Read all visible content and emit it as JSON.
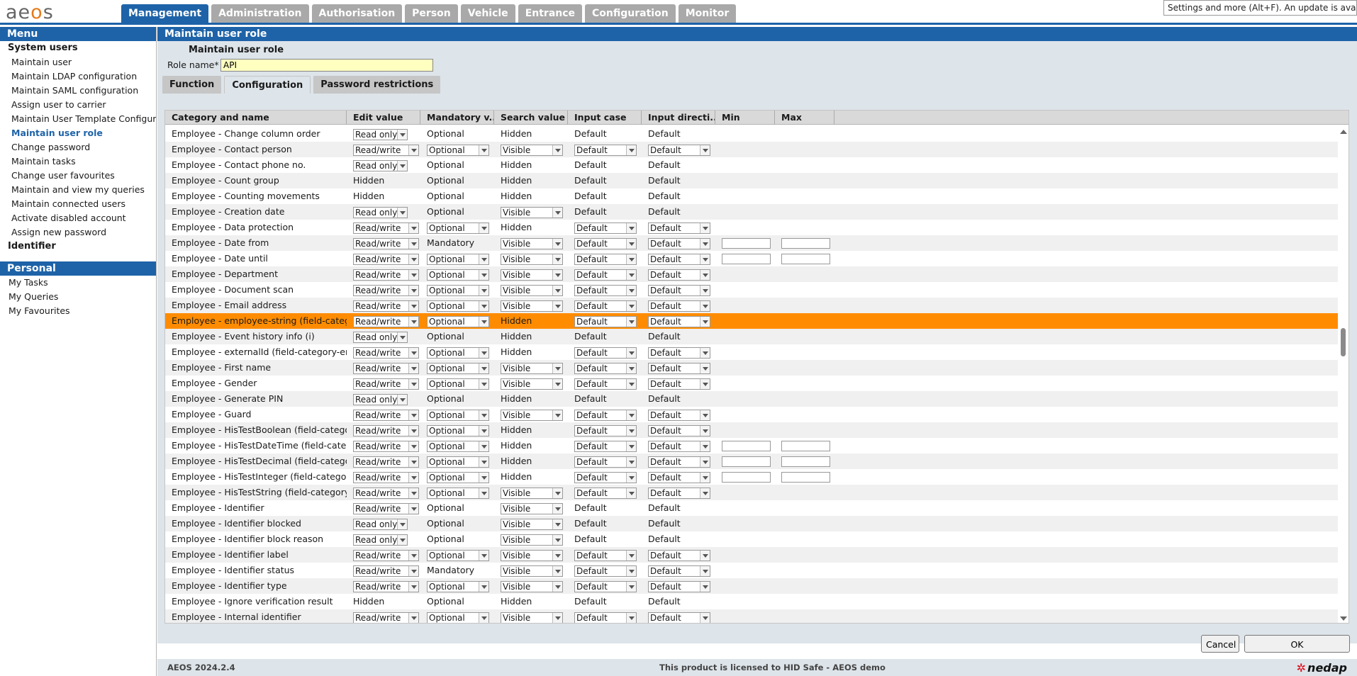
{
  "app": {
    "logo_text": "aeos"
  },
  "top_tabs": [
    "Management",
    "Administration",
    "Authorisation",
    "Person",
    "Vehicle",
    "Entrance",
    "Configuration",
    "Monitor"
  ],
  "tooltip": "Settings and more (Alt+F). An update is available.",
  "sidebar": {
    "menu_title": "Menu",
    "group1": "System users",
    "items": [
      "Maintain user",
      "Maintain LDAP configuration",
      "Maintain SAML configuration",
      "Assign user to carrier",
      "Maintain User Template Configuration",
      "Maintain user role",
      "Change password",
      "Maintain tasks",
      "Change user favourites",
      "Maintain and view my queries",
      "Maintain connected users",
      "Activate disabled account",
      "Assign new password"
    ],
    "group2": "Identifier",
    "personal_title": "Personal",
    "personal_items": [
      "My Tasks",
      "My Queries",
      "My Favourites"
    ]
  },
  "panel": {
    "title": "Maintain user role",
    "subtitle": "Maintain user role",
    "role_label": "Role name*",
    "role_value": "API",
    "tabs": [
      "Function",
      "Configuration",
      "Password restrictions"
    ]
  },
  "grid": {
    "columns": [
      "Category and name",
      "Edit value",
      "Mandatory v...",
      "Search value",
      "Input case",
      "Input directi...",
      "Min",
      "Max"
    ],
    "rows": [
      {
        "name": "Employee - Change column order",
        "edit": "Read only",
        "edit_sel": true,
        "mand": "Optional",
        "mand_sel": false,
        "search": "Hidden",
        "search_sel": false,
        "icase": "Default",
        "icase_sel": false,
        "idir": "Default",
        "idir_sel": false,
        "minmax": false
      },
      {
        "name": "Employee - Contact person",
        "edit": "Read/write",
        "edit_sel": true,
        "mand": "Optional",
        "mand_sel": true,
        "search": "Visible",
        "search_sel": true,
        "icase": "Default",
        "icase_sel": true,
        "idir": "Default",
        "idir_sel": true,
        "minmax": false
      },
      {
        "name": "Employee - Contact phone no.",
        "edit": "Read only",
        "edit_sel": true,
        "mand": "Optional",
        "mand_sel": false,
        "search": "Hidden",
        "search_sel": false,
        "icase": "Default",
        "icase_sel": false,
        "idir": "Default",
        "idir_sel": false,
        "minmax": false
      },
      {
        "name": "Employee - Count group",
        "edit": "Hidden",
        "edit_sel": false,
        "mand": "Optional",
        "mand_sel": false,
        "search": "Hidden",
        "search_sel": false,
        "icase": "Default",
        "icase_sel": false,
        "idir": "Default",
        "idir_sel": false,
        "minmax": false
      },
      {
        "name": "Employee - Counting movements",
        "edit": "Hidden",
        "edit_sel": false,
        "mand": "Optional",
        "mand_sel": false,
        "search": "Hidden",
        "search_sel": false,
        "icase": "Default",
        "icase_sel": false,
        "idir": "Default",
        "idir_sel": false,
        "minmax": false
      },
      {
        "name": "Employee - Creation date",
        "edit": "Read only",
        "edit_sel": true,
        "mand": "Optional",
        "mand_sel": false,
        "search": "Visible",
        "search_sel": true,
        "icase": "Default",
        "icase_sel": false,
        "idir": "Default",
        "idir_sel": false,
        "minmax": false
      },
      {
        "name": "Employee - Data protection",
        "edit": "Read/write",
        "edit_sel": true,
        "mand": "Optional",
        "mand_sel": true,
        "search": "Hidden",
        "search_sel": false,
        "icase": "Default",
        "icase_sel": true,
        "idir": "Default",
        "idir_sel": true,
        "minmax": false
      },
      {
        "name": "Employee - Date from",
        "edit": "Read/write",
        "edit_sel": true,
        "mand": "Mandatory",
        "mand_sel": false,
        "search": "Visible",
        "search_sel": true,
        "icase": "Default",
        "icase_sel": true,
        "idir": "Default",
        "idir_sel": true,
        "minmax": true
      },
      {
        "name": "Employee - Date until",
        "edit": "Read/write",
        "edit_sel": true,
        "mand": "Optional",
        "mand_sel": true,
        "search": "Visible",
        "search_sel": true,
        "icase": "Default",
        "icase_sel": true,
        "idir": "Default",
        "idir_sel": true,
        "minmax": true
      },
      {
        "name": "Employee - Department",
        "edit": "Read/write",
        "edit_sel": true,
        "mand": "Optional",
        "mand_sel": true,
        "search": "Visible",
        "search_sel": true,
        "icase": "Default",
        "icase_sel": true,
        "idir": "Default",
        "idir_sel": true,
        "minmax": false
      },
      {
        "name": "Employee - Document scan",
        "edit": "Read/write",
        "edit_sel": true,
        "mand": "Optional",
        "mand_sel": true,
        "search": "Visible",
        "search_sel": true,
        "icase": "Default",
        "icase_sel": true,
        "idir": "Default",
        "idir_sel": true,
        "minmax": false
      },
      {
        "name": "Employee - Email address",
        "edit": "Read/write",
        "edit_sel": true,
        "mand": "Optional",
        "mand_sel": true,
        "search": "Visible",
        "search_sel": true,
        "icase": "Default",
        "icase_sel": true,
        "idir": "Default",
        "idir_sel": true,
        "minmax": false
      },
      {
        "name": "Employee - employee-string (field-catego...",
        "edit": "Read/write",
        "edit_sel": true,
        "mand": "Optional",
        "mand_sel": true,
        "search": "Hidden",
        "search_sel": false,
        "icase": "Default",
        "icase_sel": true,
        "idir": "Default",
        "idir_sel": true,
        "minmax": false,
        "selected": true
      },
      {
        "name": "Employee - Event history info (i)",
        "edit": "Read only",
        "edit_sel": true,
        "mand": "Optional",
        "mand_sel": false,
        "search": "Hidden",
        "search_sel": false,
        "icase": "Default",
        "icase_sel": false,
        "idir": "Default",
        "idir_sel": false,
        "minmax": false
      },
      {
        "name": "Employee - externalId (field-category-em...",
        "edit": "Read/write",
        "edit_sel": true,
        "mand": "Optional",
        "mand_sel": true,
        "search": "Hidden",
        "search_sel": false,
        "icase": "Default",
        "icase_sel": true,
        "idir": "Default",
        "idir_sel": true,
        "minmax": false
      },
      {
        "name": "Employee - First name",
        "edit": "Read/write",
        "edit_sel": true,
        "mand": "Optional",
        "mand_sel": true,
        "search": "Visible",
        "search_sel": true,
        "icase": "Default",
        "icase_sel": true,
        "idir": "Default",
        "idir_sel": true,
        "minmax": false
      },
      {
        "name": "Employee - Gender",
        "edit": "Read/write",
        "edit_sel": true,
        "mand": "Optional",
        "mand_sel": true,
        "search": "Visible",
        "search_sel": true,
        "icase": "Default",
        "icase_sel": true,
        "idir": "Default",
        "idir_sel": true,
        "minmax": false
      },
      {
        "name": "Employee - Generate PIN",
        "edit": "Read only",
        "edit_sel": true,
        "mand": "Optional",
        "mand_sel": false,
        "search": "Hidden",
        "search_sel": false,
        "icase": "Default",
        "icase_sel": false,
        "idir": "Default",
        "idir_sel": false,
        "minmax": false
      },
      {
        "name": "Employee - Guard",
        "edit": "Read/write",
        "edit_sel": true,
        "mand": "Optional",
        "mand_sel": true,
        "search": "Visible",
        "search_sel": true,
        "icase": "Default",
        "icase_sel": true,
        "idir": "Default",
        "idir_sel": true,
        "minmax": false
      },
      {
        "name": "Employee - HisTestBoolean (field-categor...",
        "edit": "Read/write",
        "edit_sel": true,
        "mand": "Optional",
        "mand_sel": true,
        "search": "Hidden",
        "search_sel": false,
        "icase": "Default",
        "icase_sel": true,
        "idir": "Default",
        "idir_sel": true,
        "minmax": false
      },
      {
        "name": "Employee - HisTestDateTime (field-catego...",
        "edit": "Read/write",
        "edit_sel": true,
        "mand": "Optional",
        "mand_sel": true,
        "search": "Hidden",
        "search_sel": false,
        "icase": "Default",
        "icase_sel": true,
        "idir": "Default",
        "idir_sel": true,
        "minmax": true
      },
      {
        "name": "Employee - HisTestDecimal (field-categor...",
        "edit": "Read/write",
        "edit_sel": true,
        "mand": "Optional",
        "mand_sel": true,
        "search": "Hidden",
        "search_sel": false,
        "icase": "Default",
        "icase_sel": true,
        "idir": "Default",
        "idir_sel": true,
        "minmax": true
      },
      {
        "name": "Employee - HisTestInteger (field-category...",
        "edit": "Read/write",
        "edit_sel": true,
        "mand": "Optional",
        "mand_sel": true,
        "search": "Hidden",
        "search_sel": false,
        "icase": "Default",
        "icase_sel": true,
        "idir": "Default",
        "idir_sel": true,
        "minmax": true
      },
      {
        "name": "Employee - HisTestString (field-category-...",
        "edit": "Read/write",
        "edit_sel": true,
        "mand": "Optional",
        "mand_sel": true,
        "search": "Visible",
        "search_sel": true,
        "icase": "Default",
        "icase_sel": true,
        "idir": "Default",
        "idir_sel": true,
        "minmax": false
      },
      {
        "name": "Employee - Identifier",
        "edit": "Read/write",
        "edit_sel": true,
        "mand": "Optional",
        "mand_sel": false,
        "search": "Visible",
        "search_sel": true,
        "icase": "Default",
        "icase_sel": false,
        "idir": "Default",
        "idir_sel": false,
        "minmax": false
      },
      {
        "name": "Employee - Identifier blocked",
        "edit": "Read only",
        "edit_sel": true,
        "mand": "Optional",
        "mand_sel": false,
        "search": "Visible",
        "search_sel": true,
        "icase": "Default",
        "icase_sel": false,
        "idir": "Default",
        "idir_sel": false,
        "minmax": false
      },
      {
        "name": "Employee - Identifier block reason",
        "edit": "Read only",
        "edit_sel": true,
        "mand": "Optional",
        "mand_sel": false,
        "search": "Visible",
        "search_sel": true,
        "icase": "Default",
        "icase_sel": false,
        "idir": "Default",
        "idir_sel": false,
        "minmax": false
      },
      {
        "name": "Employee - Identifier label",
        "edit": "Read/write",
        "edit_sel": true,
        "mand": "Optional",
        "mand_sel": true,
        "search": "Visible",
        "search_sel": true,
        "icase": "Default",
        "icase_sel": true,
        "idir": "Default",
        "idir_sel": true,
        "minmax": false
      },
      {
        "name": "Employee - Identifier status",
        "edit": "Read/write",
        "edit_sel": true,
        "mand": "Mandatory",
        "mand_sel": false,
        "search": "Visible",
        "search_sel": true,
        "icase": "Default",
        "icase_sel": true,
        "idir": "Default",
        "idir_sel": true,
        "minmax": false
      },
      {
        "name": "Employee - Identifier type",
        "edit": "Read/write",
        "edit_sel": true,
        "mand": "Optional",
        "mand_sel": true,
        "search": "Visible",
        "search_sel": true,
        "icase": "Default",
        "icase_sel": true,
        "idir": "Default",
        "idir_sel": true,
        "minmax": false
      },
      {
        "name": "Employee - Ignore verification result",
        "edit": "Hidden",
        "edit_sel": false,
        "mand": "Optional",
        "mand_sel": false,
        "search": "Hidden",
        "search_sel": false,
        "icase": "Default",
        "icase_sel": false,
        "idir": "Default",
        "idir_sel": false,
        "minmax": false
      },
      {
        "name": "Employee - Internal identifier",
        "edit": "Read/write",
        "edit_sel": true,
        "mand": "Optional",
        "mand_sel": true,
        "search": "Visible",
        "search_sel": true,
        "icase": "Default",
        "icase_sel": true,
        "idir": "Default",
        "idir_sel": true,
        "minmax": false
      }
    ]
  },
  "buttons": {
    "cancel": "Cancel",
    "ok": "OK"
  },
  "footer": {
    "version": "AEOS 2024.2.4",
    "license": "This product is licensed to HID Safe - AEOS demo",
    "brand": "nedap"
  },
  "colors": {
    "accent": "#1e63a8",
    "selection": "#ff8c00",
    "logo_o": "#e57a1b"
  }
}
